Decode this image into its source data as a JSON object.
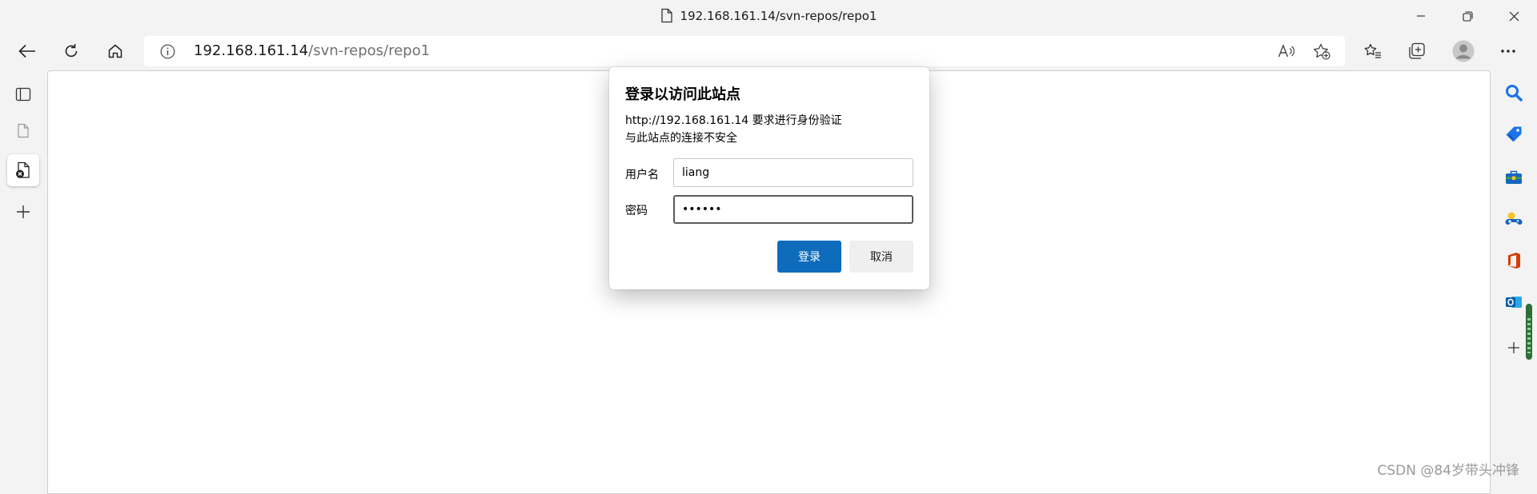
{
  "window": {
    "title": "192.168.161.14/svn-repos/repo1"
  },
  "toolbar": {
    "url_host": "192.168.161.14",
    "url_path": "/svn-repos/repo1"
  },
  "dialog": {
    "title": "登录以访问此站点",
    "message_line1": "http://192.168.161.14 要求进行身份验证",
    "message_line2": "与此站点的连接不安全",
    "username_label": "用户名",
    "username_value": "liang",
    "password_label": "密码",
    "password_value": "••••••",
    "login_button": "登录",
    "cancel_button": "取消"
  },
  "watermark": "CSDN @84岁带头冲锋",
  "icons": {
    "titlebar": [
      "page-icon",
      "minimize-icon",
      "restore-icon",
      "close-icon"
    ],
    "toolbar": [
      "back-icon",
      "refresh-icon",
      "home-icon",
      "info-icon",
      "read-aloud-icon",
      "add-favorite-icon",
      "favorites-icon",
      "collections-icon",
      "profile-icon",
      "more-icon"
    ],
    "left_sidebar": [
      "tab-actions-icon",
      "blank-tab-icon",
      "active-tab-icon",
      "new-tab-icon"
    ],
    "right_sidebar": [
      "search-icon",
      "shopping-icon",
      "tools-icon",
      "games-icon",
      "office-icon",
      "outlook-icon",
      "add-icon"
    ]
  },
  "colors": {
    "chrome_background": "#f3f3f3",
    "primary_button": "#0f6cbd",
    "search_blue": "#1a73e8",
    "office_red": "#d83b01",
    "outlook_blue": "#0a5ea8"
  }
}
